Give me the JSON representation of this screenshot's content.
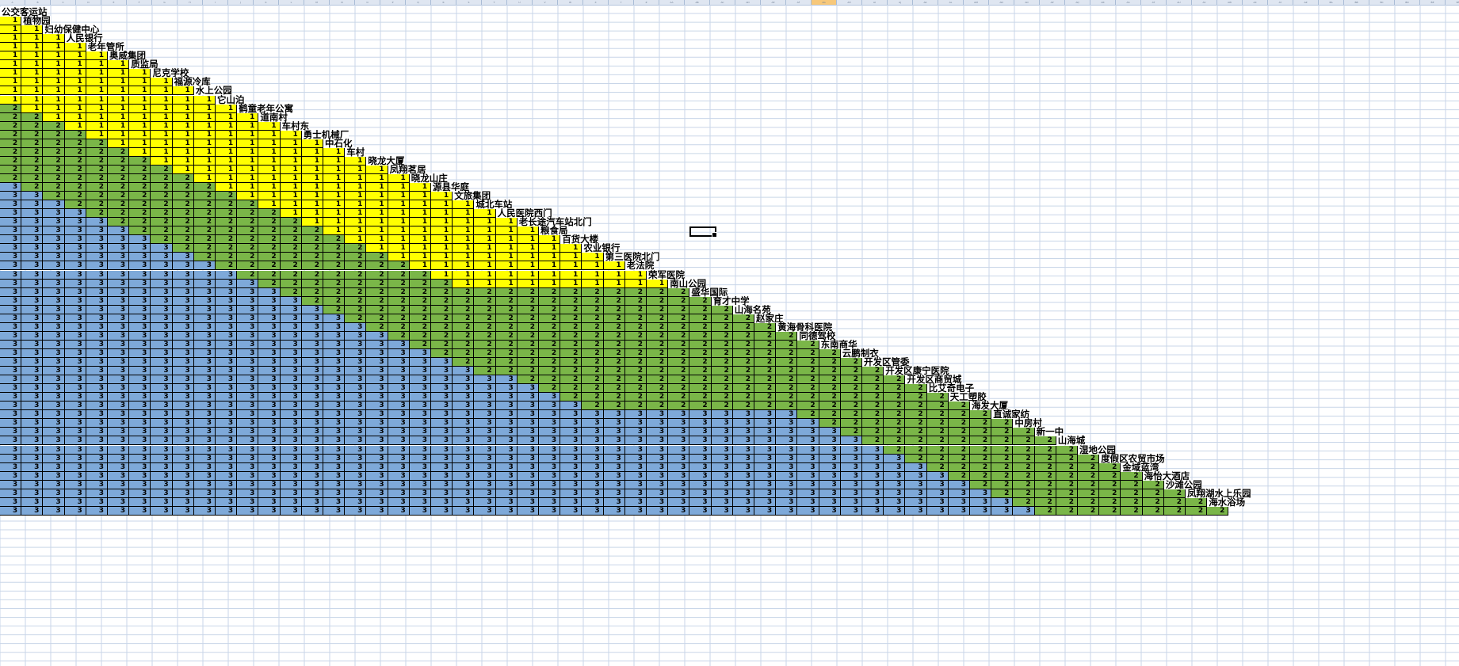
{
  "window": {
    "title": ""
  },
  "column_headers": [
    "A",
    "B",
    "C",
    "D",
    "E",
    "F",
    "G",
    "H",
    "I",
    "J",
    "K",
    "L",
    "M",
    "N",
    "O",
    "P",
    "Q",
    "R",
    "S",
    "T",
    "U",
    "V",
    "W",
    "X",
    "Y",
    "Z",
    "AA",
    "AB",
    "AC",
    "AD",
    "AE",
    "AF",
    "AG",
    "AH",
    "AI",
    "AJ",
    "AK",
    "AL",
    "AM",
    "AN",
    "AO",
    "AP",
    "AQ",
    "AR",
    "AS",
    "AT",
    "AU",
    "AV",
    "AW",
    "AX",
    "AY",
    "AZ",
    "BA",
    "BB",
    "BC",
    "BD",
    "BE",
    "BF"
  ],
  "active_column_index": 32,
  "colors": {
    "zone1": "#ffff00",
    "zone2": "#7ab648",
    "zone3": "#7ea9d9",
    "grid_line": "#c9d6e8",
    "cell_border": "#000000"
  },
  "stops": [
    "公交客运站",
    "植物园",
    "妇幼保健中心",
    "人民银行",
    "老年管所",
    "奥威集团",
    "质监局",
    "尼克学校",
    "福源冷库",
    "水上公园",
    "它山泊",
    "鹤童老年公寓",
    "道南村",
    "车村东",
    "勇士机械厂",
    "中石化",
    "车村",
    "晓龙大厦",
    "凤翔茗居",
    "晓龙山庄",
    "源县华庭",
    "文旅集团",
    "城北车站",
    "人民医院西门",
    "老长途汽车站北门",
    "粮食局",
    "百货大楼",
    "农业银行",
    "第三医院北门",
    "老法院",
    "荣军医院",
    "南山公园",
    "盛华国际",
    "育才中学",
    "山海名苑",
    "赵家庄",
    "黄海骨科医院",
    "同德驾校",
    "东南商华",
    "云鹏制衣",
    "开发区管委",
    "开发区康宁医院",
    "开发区商贸城",
    "比艾奇电子",
    "天工塑胶",
    "海发大厦",
    "直诚家纺",
    "中房村",
    "新一中",
    "山海城",
    "湿地公园",
    "度假区农贸市场",
    "金域蓝湾",
    "海怡大酒店",
    "沙滩公园",
    "凤翔湖水上乐园",
    "海水浴场"
  ],
  "fare_matrix": [
    [],
    [
      1
    ],
    [
      1,
      1
    ],
    [
      1,
      1,
      1
    ],
    [
      1,
      1,
      1,
      1
    ],
    [
      1,
      1,
      1,
      1,
      1
    ],
    [
      1,
      1,
      1,
      1,
      1,
      1
    ],
    [
      1,
      1,
      1,
      1,
      1,
      1,
      1
    ],
    [
      1,
      1,
      1,
      1,
      1,
      1,
      1,
      1
    ],
    [
      1,
      1,
      1,
      1,
      1,
      1,
      1,
      1,
      1
    ],
    [
      1,
      1,
      1,
      1,
      1,
      1,
      1,
      1,
      1,
      1
    ],
    [
      2,
      1,
      1,
      1,
      1,
      1,
      1,
      1,
      1,
      1,
      1
    ],
    [
      2,
      2,
      1,
      1,
      1,
      1,
      1,
      1,
      1,
      1,
      1,
      1
    ],
    [
      2,
      2,
      2,
      1,
      1,
      1,
      1,
      1,
      1,
      1,
      1,
      1,
      1
    ],
    [
      2,
      2,
      2,
      2,
      1,
      1,
      1,
      1,
      1,
      1,
      1,
      1,
      1,
      1
    ],
    [
      2,
      2,
      2,
      2,
      2,
      1,
      1,
      1,
      1,
      1,
      1,
      1,
      1,
      1,
      1
    ],
    [
      2,
      2,
      2,
      2,
      2,
      2,
      1,
      1,
      1,
      1,
      1,
      1,
      1,
      1,
      1,
      1
    ],
    [
      2,
      2,
      2,
      2,
      2,
      2,
      2,
      1,
      1,
      1,
      1,
      1,
      1,
      1,
      1,
      1,
      1
    ],
    [
      2,
      2,
      2,
      2,
      2,
      2,
      2,
      2,
      1,
      1,
      1,
      1,
      1,
      1,
      1,
      1,
      1,
      1
    ],
    [
      2,
      2,
      2,
      2,
      2,
      2,
      2,
      2,
      2,
      1,
      1,
      1,
      1,
      1,
      1,
      1,
      1,
      1,
      1
    ],
    [
      3,
      2,
      2,
      2,
      2,
      2,
      2,
      2,
      2,
      2,
      1,
      1,
      1,
      1,
      1,
      1,
      1,
      1,
      1,
      1
    ],
    [
      3,
      3,
      2,
      2,
      2,
      2,
      2,
      2,
      2,
      2,
      2,
      1,
      1,
      1,
      1,
      1,
      1,
      1,
      1,
      1,
      1
    ],
    [
      3,
      3,
      3,
      2,
      2,
      2,
      2,
      2,
      2,
      2,
      2,
      2,
      1,
      1,
      1,
      1,
      1,
      1,
      1,
      1,
      1,
      1
    ],
    [
      3,
      3,
      3,
      3,
      2,
      2,
      2,
      2,
      2,
      2,
      2,
      2,
      2,
      1,
      1,
      1,
      1,
      1,
      1,
      1,
      1,
      1,
      1
    ],
    [
      3,
      3,
      3,
      3,
      3,
      2,
      2,
      2,
      2,
      2,
      2,
      2,
      2,
      2,
      1,
      1,
      1,
      1,
      1,
      1,
      1,
      1,
      1,
      1
    ],
    [
      3,
      3,
      3,
      3,
      3,
      3,
      2,
      2,
      2,
      2,
      2,
      2,
      2,
      2,
      2,
      1,
      1,
      1,
      1,
      1,
      1,
      1,
      1,
      1,
      1
    ],
    [
      3,
      3,
      3,
      3,
      3,
      3,
      3,
      2,
      2,
      2,
      2,
      2,
      2,
      2,
      2,
      2,
      1,
      1,
      1,
      1,
      1,
      1,
      1,
      1,
      1,
      1
    ],
    [
      3,
      3,
      3,
      3,
      3,
      3,
      3,
      3,
      2,
      2,
      2,
      2,
      2,
      2,
      2,
      2,
      2,
      1,
      1,
      1,
      1,
      1,
      1,
      1,
      1,
      1,
      1
    ],
    [
      3,
      3,
      3,
      3,
      3,
      3,
      3,
      3,
      3,
      2,
      2,
      2,
      2,
      2,
      2,
      2,
      2,
      2,
      1,
      1,
      1,
      1,
      1,
      1,
      1,
      1,
      1,
      1
    ],
    [
      3,
      3,
      3,
      3,
      3,
      3,
      3,
      3,
      3,
      3,
      2,
      2,
      2,
      2,
      2,
      2,
      2,
      2,
      2,
      1,
      1,
      1,
      1,
      1,
      1,
      1,
      1,
      1,
      1
    ],
    [
      3,
      3,
      3,
      3,
      3,
      3,
      3,
      3,
      3,
      3,
      3,
      2,
      2,
      2,
      2,
      2,
      2,
      2,
      2,
      2,
      1,
      1,
      1,
      1,
      1,
      1,
      1,
      1,
      1,
      1
    ],
    [
      3,
      3,
      3,
      3,
      3,
      3,
      3,
      3,
      3,
      3,
      3,
      3,
      2,
      2,
      2,
      2,
      2,
      2,
      2,
      2,
      2,
      1,
      1,
      1,
      1,
      1,
      1,
      1,
      1,
      1,
      1
    ],
    [
      3,
      3,
      3,
      3,
      3,
      3,
      3,
      3,
      3,
      3,
      3,
      3,
      3,
      2,
      2,
      2,
      2,
      2,
      2,
      2,
      2,
      2,
      2,
      2,
      2,
      2,
      2,
      2,
      2,
      2,
      2,
      2
    ],
    [
      3,
      3,
      3,
      3,
      3,
      3,
      3,
      3,
      3,
      3,
      3,
      3,
      3,
      3,
      2,
      2,
      2,
      2,
      2,
      2,
      2,
      2,
      2,
      2,
      2,
      2,
      2,
      2,
      2,
      2,
      2,
      2,
      2
    ],
    [
      3,
      3,
      3,
      3,
      3,
      3,
      3,
      3,
      3,
      3,
      3,
      3,
      3,
      3,
      3,
      2,
      2,
      2,
      2,
      2,
      2,
      2,
      2,
      2,
      2,
      2,
      2,
      2,
      2,
      2,
      2,
      2,
      2,
      2
    ],
    [
      3,
      3,
      3,
      3,
      3,
      3,
      3,
      3,
      3,
      3,
      3,
      3,
      3,
      3,
      3,
      3,
      2,
      2,
      2,
      2,
      2,
      2,
      2,
      2,
      2,
      2,
      2,
      2,
      2,
      2,
      2,
      2,
      2,
      2,
      2
    ],
    [
      3,
      3,
      3,
      3,
      3,
      3,
      3,
      3,
      3,
      3,
      3,
      3,
      3,
      3,
      3,
      3,
      3,
      2,
      2,
      2,
      2,
      2,
      2,
      2,
      2,
      2,
      2,
      2,
      2,
      2,
      2,
      2,
      2,
      2,
      2,
      2
    ],
    [
      3,
      3,
      3,
      3,
      3,
      3,
      3,
      3,
      3,
      3,
      3,
      3,
      3,
      3,
      3,
      3,
      3,
      3,
      2,
      2,
      2,
      2,
      2,
      2,
      2,
      2,
      2,
      2,
      2,
      2,
      2,
      2,
      2,
      2,
      2,
      2,
      2
    ],
    [
      3,
      3,
      3,
      3,
      3,
      3,
      3,
      3,
      3,
      3,
      3,
      3,
      3,
      3,
      3,
      3,
      3,
      3,
      3,
      2,
      2,
      2,
      2,
      2,
      2,
      2,
      2,
      2,
      2,
      2,
      2,
      2,
      2,
      2,
      2,
      2,
      2,
      2
    ],
    [
      3,
      3,
      3,
      3,
      3,
      3,
      3,
      3,
      3,
      3,
      3,
      3,
      3,
      3,
      3,
      3,
      3,
      3,
      3,
      3,
      2,
      2,
      2,
      2,
      2,
      2,
      2,
      2,
      2,
      2,
      2,
      2,
      2,
      2,
      2,
      2,
      2,
      2,
      2
    ],
    [
      3,
      3,
      3,
      3,
      3,
      3,
      3,
      3,
      3,
      3,
      3,
      3,
      3,
      3,
      3,
      3,
      3,
      3,
      3,
      3,
      3,
      2,
      2,
      2,
      2,
      2,
      2,
      2,
      2,
      2,
      2,
      2,
      2,
      2,
      2,
      2,
      2,
      2,
      2,
      2
    ],
    [
      3,
      3,
      3,
      3,
      3,
      3,
      3,
      3,
      3,
      3,
      3,
      3,
      3,
      3,
      3,
      3,
      3,
      3,
      3,
      3,
      3,
      3,
      2,
      2,
      2,
      2,
      2,
      2,
      2,
      2,
      2,
      2,
      2,
      2,
      2,
      2,
      2,
      2,
      2,
      2,
      2
    ],
    [
      3,
      3,
      3,
      3,
      3,
      3,
      3,
      3,
      3,
      3,
      3,
      3,
      3,
      3,
      3,
      3,
      3,
      3,
      3,
      3,
      3,
      3,
      3,
      3,
      2,
      2,
      2,
      2,
      2,
      2,
      2,
      2,
      2,
      2,
      2,
      2,
      2,
      2,
      2,
      2,
      2,
      2
    ],
    [
      3,
      3,
      3,
      3,
      3,
      3,
      3,
      3,
      3,
      3,
      3,
      3,
      3,
      3,
      3,
      3,
      3,
      3,
      3,
      3,
      3,
      3,
      3,
      3,
      3,
      2,
      2,
      2,
      2,
      2,
      2,
      2,
      2,
      2,
      2,
      2,
      2,
      2,
      2,
      2,
      2,
      2,
      2
    ],
    [
      3,
      3,
      3,
      3,
      3,
      3,
      3,
      3,
      3,
      3,
      3,
      3,
      3,
      3,
      3,
      3,
      3,
      3,
      3,
      3,
      3,
      3,
      3,
      3,
      3,
      3,
      2,
      2,
      2,
      2,
      2,
      2,
      2,
      2,
      2,
      2,
      2,
      2,
      2,
      2,
      2,
      2,
      2,
      2
    ],
    [
      3,
      3,
      3,
      3,
      3,
      3,
      3,
      3,
      3,
      3,
      3,
      3,
      3,
      3,
      3,
      3,
      3,
      3,
      3,
      3,
      3,
      3,
      3,
      3,
      3,
      3,
      3,
      2,
      2,
      2,
      2,
      2,
      2,
      2,
      2,
      2,
      2,
      2,
      2,
      2,
      2,
      2,
      2,
      2,
      2
    ],
    [
      3,
      3,
      3,
      3,
      3,
      3,
      3,
      3,
      3,
      3,
      3,
      3,
      3,
      3,
      3,
      3,
      3,
      3,
      3,
      3,
      3,
      3,
      3,
      3,
      3,
      3,
      3,
      3,
      3,
      3,
      3,
      3,
      3,
      3,
      3,
      3,
      3,
      2,
      2,
      2,
      2,
      2,
      2,
      2,
      2,
      2
    ],
    [
      3,
      3,
      3,
      3,
      3,
      3,
      3,
      3,
      3,
      3,
      3,
      3,
      3,
      3,
      3,
      3,
      3,
      3,
      3,
      3,
      3,
      3,
      3,
      3,
      3,
      3,
      3,
      3,
      3,
      3,
      3,
      3,
      3,
      3,
      3,
      3,
      3,
      3,
      2,
      2,
      2,
      2,
      2,
      2,
      2,
      2,
      2
    ],
    [
      3,
      3,
      3,
      3,
      3,
      3,
      3,
      3,
      3,
      3,
      3,
      3,
      3,
      3,
      3,
      3,
      3,
      3,
      3,
      3,
      3,
      3,
      3,
      3,
      3,
      3,
      3,
      3,
      3,
      3,
      3,
      3,
      3,
      3,
      3,
      3,
      3,
      3,
      3,
      2,
      2,
      2,
      2,
      2,
      2,
      2,
      2,
      2
    ],
    [
      3,
      3,
      3,
      3,
      3,
      3,
      3,
      3,
      3,
      3,
      3,
      3,
      3,
      3,
      3,
      3,
      3,
      3,
      3,
      3,
      3,
      3,
      3,
      3,
      3,
      3,
      3,
      3,
      3,
      3,
      3,
      3,
      3,
      3,
      3,
      3,
      3,
      3,
      3,
      3,
      2,
      2,
      2,
      2,
      2,
      2,
      2,
      2,
      2
    ],
    [
      3,
      3,
      3,
      3,
      3,
      3,
      3,
      3,
      3,
      3,
      3,
      3,
      3,
      3,
      3,
      3,
      3,
      3,
      3,
      3,
      3,
      3,
      3,
      3,
      3,
      3,
      3,
      3,
      3,
      3,
      3,
      3,
      3,
      3,
      3,
      3,
      3,
      3,
      3,
      3,
      3,
      2,
      2,
      2,
      2,
      2,
      2,
      2,
      2,
      2
    ],
    [
      3,
      3,
      3,
      3,
      3,
      3,
      3,
      3,
      3,
      3,
      3,
      3,
      3,
      3,
      3,
      3,
      3,
      3,
      3,
      3,
      3,
      3,
      3,
      3,
      3,
      3,
      3,
      3,
      3,
      3,
      3,
      3,
      3,
      3,
      3,
      3,
      3,
      3,
      3,
      3,
      3,
      3,
      2,
      2,
      2,
      2,
      2,
      2,
      2,
      2,
      2
    ],
    [
      3,
      3,
      3,
      3,
      3,
      3,
      3,
      3,
      3,
      3,
      3,
      3,
      3,
      3,
      3,
      3,
      3,
      3,
      3,
      3,
      3,
      3,
      3,
      3,
      3,
      3,
      3,
      3,
      3,
      3,
      3,
      3,
      3,
      3,
      3,
      3,
      3,
      3,
      3,
      3,
      3,
      3,
      3,
      2,
      2,
      2,
      2,
      2,
      2,
      2,
      2,
      2
    ],
    [
      3,
      3,
      3,
      3,
      3,
      3,
      3,
      3,
      3,
      3,
      3,
      3,
      3,
      3,
      3,
      3,
      3,
      3,
      3,
      3,
      3,
      3,
      3,
      3,
      3,
      3,
      3,
      3,
      3,
      3,
      3,
      3,
      3,
      3,
      3,
      3,
      3,
      3,
      3,
      3,
      3,
      3,
      3,
      3,
      2,
      2,
      2,
      2,
      2,
      2,
      2,
      2,
      2
    ],
    [
      3,
      3,
      3,
      3,
      3,
      3,
      3,
      3,
      3,
      3,
      3,
      3,
      3,
      3,
      3,
      3,
      3,
      3,
      3,
      3,
      3,
      3,
      3,
      3,
      3,
      3,
      3,
      3,
      3,
      3,
      3,
      3,
      3,
      3,
      3,
      3,
      3,
      3,
      3,
      3,
      3,
      3,
      3,
      3,
      3,
      2,
      2,
      2,
      2,
      2,
      2,
      2,
      2,
      2
    ],
    [
      3,
      3,
      3,
      3,
      3,
      3,
      3,
      3,
      3,
      3,
      3,
      3,
      3,
      3,
      3,
      3,
      3,
      3,
      3,
      3,
      3,
      3,
      3,
      3,
      3,
      3,
      3,
      3,
      3,
      3,
      3,
      3,
      3,
      3,
      3,
      3,
      3,
      3,
      3,
      3,
      3,
      3,
      3,
      3,
      3,
      3,
      2,
      2,
      2,
      2,
      2,
      2,
      2,
      2,
      2
    ],
    [
      3,
      3,
      3,
      3,
      3,
      3,
      3,
      3,
      3,
      3,
      3,
      3,
      3,
      3,
      3,
      3,
      3,
      3,
      3,
      3,
      3,
      3,
      3,
      3,
      3,
      3,
      3,
      3,
      3,
      3,
      3,
      3,
      3,
      3,
      3,
      3,
      3,
      3,
      3,
      3,
      3,
      3,
      3,
      3,
      3,
      3,
      3,
      2,
      2,
      2,
      2,
      2,
      2,
      2,
      2,
      2
    ],
    [
      3,
      3,
      3,
      3,
      3,
      3,
      3,
      3,
      3,
      3,
      3,
      3,
      3,
      3,
      3,
      3,
      3,
      3,
      3,
      3,
      3,
      3,
      3,
      3,
      3,
      3,
      3,
      3,
      3,
      3,
      3,
      3,
      3,
      3,
      3,
      3,
      3,
      3,
      3,
      3,
      3,
      3,
      3,
      3,
      3,
      3,
      3,
      3,
      2,
      2,
      2,
      2,
      2,
      2,
      2,
      2,
      2
    ]
  ]
}
